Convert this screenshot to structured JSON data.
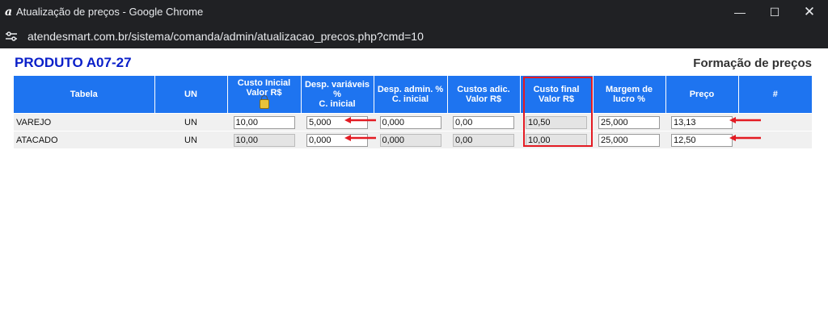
{
  "window": {
    "title": "Atualização de preços - Google Chrome",
    "url": "atendesmart.com.br/sistema/comanda/admin/atualizacao_precos.php?cmd=10"
  },
  "page": {
    "product_title": "PRODUTO A07-27",
    "section_title": "Formação de preços"
  },
  "table": {
    "headers": {
      "tabela": "Tabela",
      "un": "UN",
      "custo_inicial_1": "Custo Inicial",
      "custo_inicial_2": "Valor R$",
      "desp_var_1": "Desp. variáveis",
      "desp_var_2": "%",
      "desp_var_3": "C. inicial",
      "desp_admin_1": "Desp. admin. %",
      "desp_admin_2": "C. inicial",
      "custos_adic_1": "Custos adic.",
      "custos_adic_2": "Valor R$",
      "custo_final_1": "Custo final",
      "custo_final_2": "Valor R$",
      "margem_1": "Margem de",
      "margem_2": "lucro %",
      "preco": "Preço",
      "hash": "#"
    },
    "rows": [
      {
        "tabela": "VAREJO",
        "un": "UN",
        "custo_inicial": "10,00",
        "desp_var": "5,000",
        "desp_admin": "0,000",
        "custos_adic": "0,00",
        "custo_final": "10,50",
        "margem": "25,000",
        "preco": "13,13"
      },
      {
        "tabela": "ATACADO",
        "un": "UN",
        "custo_inicial": "10,00",
        "desp_var": "0,000",
        "desp_admin": "0,000",
        "custos_adic": "0,00",
        "custo_final": "10,00",
        "margem": "25,000",
        "preco": "12,50"
      }
    ]
  },
  "colors": {
    "header_bg": "#1e74f0",
    "annotation": "#e31b23",
    "title": "#0a1fc9"
  }
}
